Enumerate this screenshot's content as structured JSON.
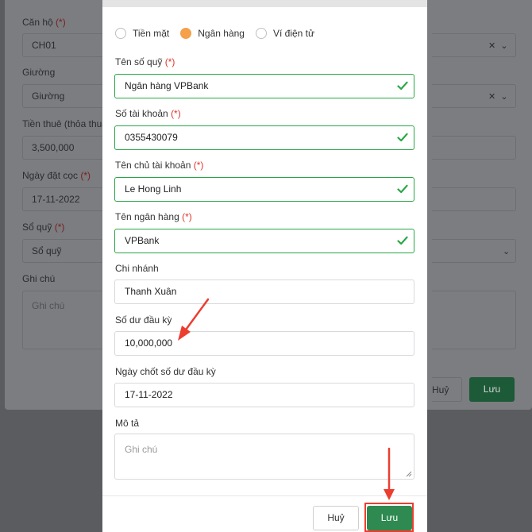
{
  "background_form": {
    "apartment_label": "Căn hộ",
    "apartment_value": "CH01",
    "bed_label": "Giường",
    "bed_value": "Giường",
    "rent_label": "Tiền thuê (thỏa thuận",
    "rent_value": "3,500,000",
    "deposit_date_label": "Ngày đặt cọc",
    "deposit_date_value": "17-11-2022",
    "fund_label": "Sổ quỹ",
    "fund_value": "Sổ quỹ",
    "note_label": "Ghi chú",
    "note_placeholder": "Ghi chú",
    "required_mark": "(*)",
    "cancel_label": "Huỷ",
    "save_label": "Lưu"
  },
  "dialog": {
    "payment_methods": [
      {
        "label": "Tiền mặt",
        "checked": false
      },
      {
        "label": "Ngân hàng",
        "checked": true
      },
      {
        "label": "Ví điện tử",
        "checked": false
      }
    ],
    "required_mark": "(*)",
    "fund_name_label": "Tên số quỹ",
    "fund_name_value": "Ngân hàng VPBank",
    "account_number_label": "Số tài khoản",
    "account_number_value": "0355430079",
    "account_holder_label": "Tên chủ tài khoản",
    "account_holder_value": "Le Hong Linh",
    "bank_name_label": "Tên ngân hàng",
    "bank_name_value": "VPBank",
    "branch_label": "Chi nhánh",
    "branch_value": "Thanh Xuân",
    "opening_balance_label": "Số dư đầu kỳ",
    "opening_balance_value": "10,000,000",
    "closing_date_label": "Ngày chốt số dư đầu kỳ",
    "closing_date_value": "17-11-2022",
    "description_label": "Mô tả",
    "description_placeholder": "Ghi chú",
    "cancel_label": "Huỷ",
    "save_label": "Lưu"
  },
  "colors": {
    "accent_radio": "#f5a04b",
    "valid_border": "#28a745",
    "save_button": "#2e8a50",
    "required": "#e0342a",
    "annotation": "#ec3d2f"
  }
}
